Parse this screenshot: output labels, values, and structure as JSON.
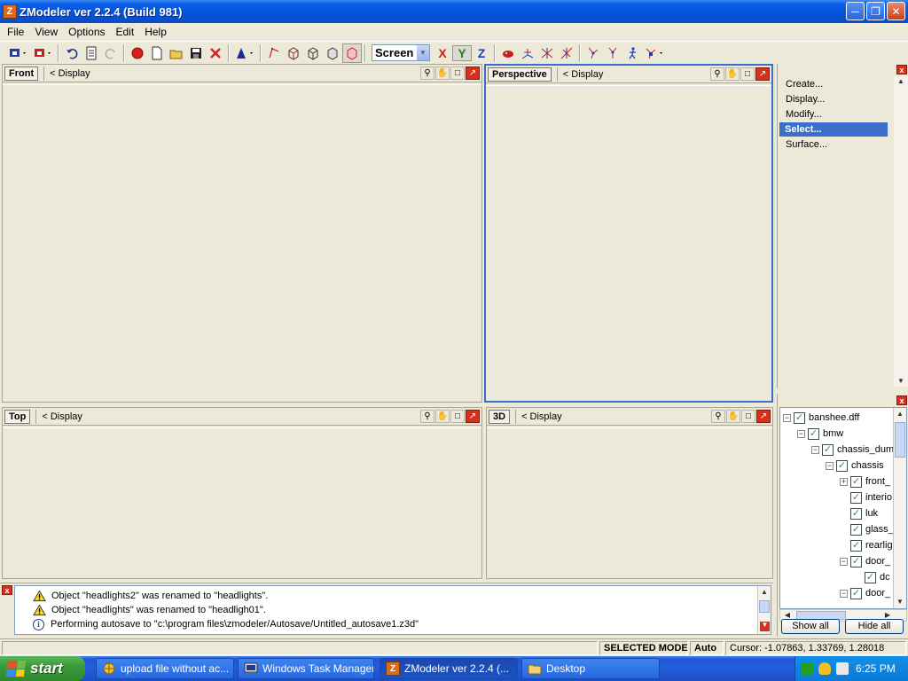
{
  "window": {
    "title": "ZModeler ver 2.2.4 (Build 981)",
    "icon": "zmodeler-app-icon"
  },
  "menu": [
    "File",
    "View",
    "Options",
    "Edit",
    "Help"
  ],
  "toolbar": {
    "coord_select": "Screen",
    "axes": [
      {
        "label": "X",
        "color": "#c8201c"
      },
      {
        "label": "Y",
        "color": "#208020"
      },
      {
        "label": "Z",
        "color": "#1c3cc0"
      }
    ]
  },
  "viewports": {
    "front": {
      "name": "Front",
      "display": "<  Display"
    },
    "perspective": {
      "name": "Perspective",
      "display": "<  Display"
    },
    "top": {
      "name": "Top",
      "display": "<  Display"
    },
    "view3d": {
      "name": "3D",
      "display": "<  Display"
    }
  },
  "command_panel": {
    "items": [
      "Create...",
      "Display...",
      "Modify...",
      "Select...",
      "Surface..."
    ],
    "selected": "Select..."
  },
  "tree": {
    "items": [
      {
        "label": "banshee.dff",
        "depth": 0,
        "expander": "minus"
      },
      {
        "label": "bmw",
        "depth": 1,
        "expander": "minus"
      },
      {
        "label": "chassis_dum",
        "depth": 2,
        "expander": "minus"
      },
      {
        "label": "chassis",
        "depth": 3,
        "expander": "minus"
      },
      {
        "label": "front_",
        "depth": 4,
        "expander": "plus"
      },
      {
        "label": "interio",
        "depth": 4,
        "expander": "none"
      },
      {
        "label": "luk",
        "depth": 4,
        "expander": "none"
      },
      {
        "label": "glass_",
        "depth": 4,
        "expander": "none"
      },
      {
        "label": "rearlig",
        "depth": 4,
        "expander": "none"
      },
      {
        "label": "door_",
        "depth": 4,
        "expander": "minus"
      },
      {
        "label": "dc",
        "depth": 5,
        "expander": "none"
      },
      {
        "label": "door_",
        "depth": 4,
        "expander": "minus"
      }
    ],
    "show_all": "Show all",
    "hide_all": "Hide all"
  },
  "log": [
    {
      "type": "warning",
      "text": "Object \"headlights2\" was renamed to \"headlights\"."
    },
    {
      "type": "warning",
      "text": "Object \"headlights\" was renamed to \"headligh01\"."
    },
    {
      "type": "info",
      "text": "Performing autosave to \"c:\\program files\\zmodeler/Autosave/Untitled_autosave1.z3d\""
    }
  ],
  "status": {
    "mode": "SELECTED MODE",
    "auto": "Auto",
    "cursor": "Cursor: -1.07863, 1.33769, 1.28018"
  },
  "taskbar": {
    "start": "start",
    "tasks": [
      {
        "label": "upload file without ac...",
        "icon": "browser-icon",
        "active": false
      },
      {
        "label": "Windows Task Manager",
        "icon": "task-manager-icon",
        "active": false
      },
      {
        "label": "ZModeler ver 2.2.4 (...",
        "icon": "zmodeler-app-icon",
        "active": true
      },
      {
        "label": "Desktop",
        "icon": "folder-icon",
        "active": false
      }
    ],
    "clock": "6:25 PM"
  }
}
